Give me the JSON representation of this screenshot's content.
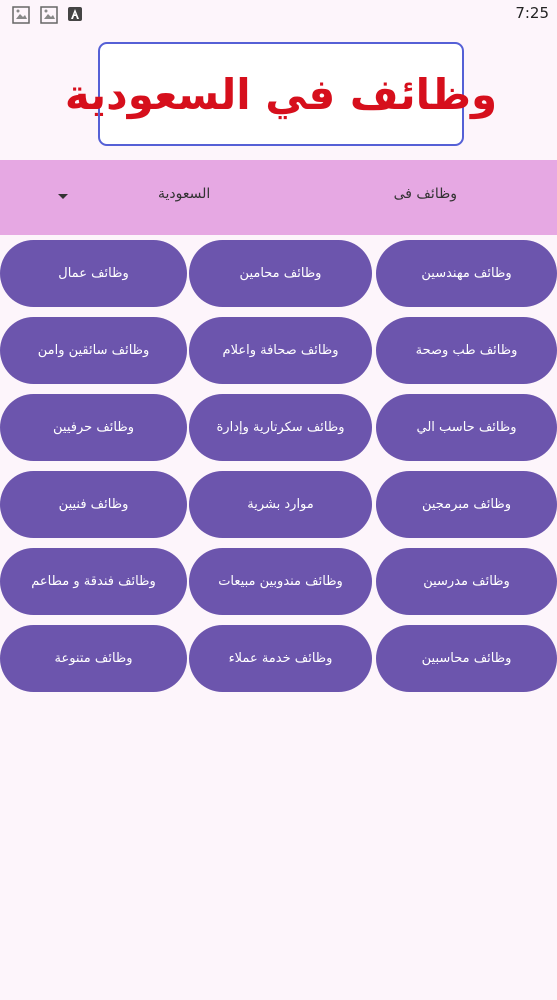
{
  "status": {
    "time": "7:25"
  },
  "logo": {
    "text": "وظائف في السعودية"
  },
  "filter": {
    "label": "وظائف فى",
    "country": "السعودية"
  },
  "categories": [
    [
      "وظائف مهندسين",
      "وظائف محامين",
      "وظائف عمال"
    ],
    [
      "وظائف طب وصحة",
      "وظائف صحافة واعلام",
      "وظائف سائقين وامن"
    ],
    [
      "وظائف حاسب الي",
      "وظائف سكرتارية وإدارة",
      "وظائف حرفيين"
    ],
    [
      "وظائف مبرمجين",
      "موارد بشرية",
      "وظائف فنيين"
    ],
    [
      "وظائف مدرسين",
      "وظائف مندوبين مبيعات",
      "وظائف فندقة و مطاعم"
    ],
    [
      "وظائف محاسبين",
      "وظائف خدمة عملاء",
      "وظائف متنوعة"
    ]
  ],
  "colors": {
    "background": "#fdf5fb",
    "filter_bar": "#e6a8e3",
    "button": "#6c55ad",
    "logo_text": "#d60f1c",
    "logo_border": "#5560d6"
  }
}
